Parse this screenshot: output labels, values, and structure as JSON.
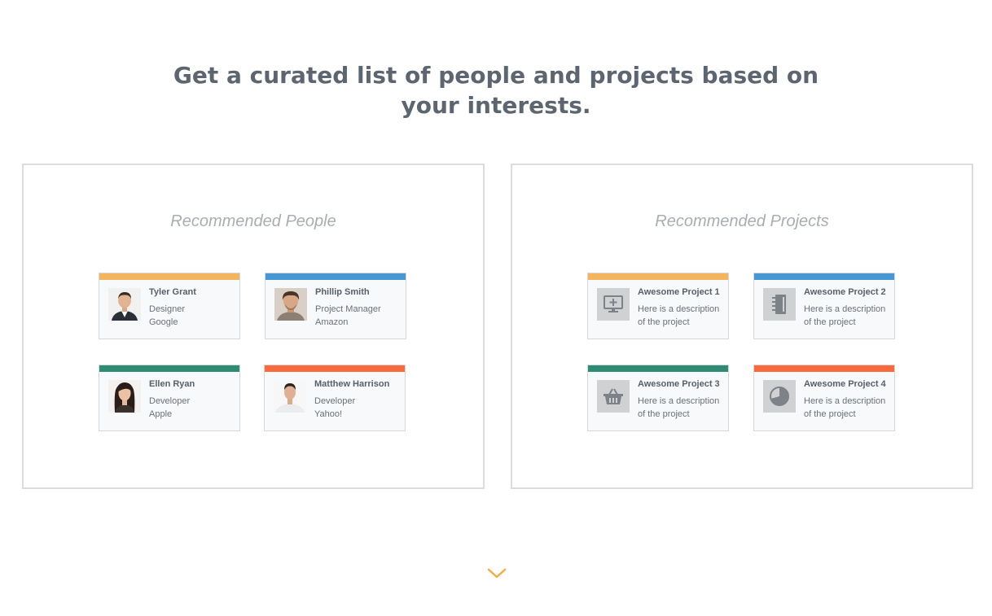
{
  "headline": {
    "line1": "Get a curated list of people and projects based on",
    "line2": "your interests."
  },
  "colors": {
    "yellow": "#f2b45c",
    "blue": "#4896d2",
    "green": "#2e8b74",
    "orange": "#f86a3c",
    "chevron": "#f0ad4e"
  },
  "people_panel": {
    "title": "Recommended People",
    "cards": [
      {
        "name": "Tyler Grant",
        "role": "Designer",
        "company": "Google",
        "accent": "yellow"
      },
      {
        "name": "Phillip Smith",
        "role": "Project Manager",
        "company": "Amazon",
        "accent": "blue"
      },
      {
        "name": "Ellen Ryan",
        "role": "Developer",
        "company": "Apple",
        "accent": "green"
      },
      {
        "name": "Matthew Harrison",
        "role": "Developer",
        "company": "Yahoo!",
        "accent": "orange"
      }
    ]
  },
  "projects_panel": {
    "title": "Recommended Projects",
    "cards": [
      {
        "name": "Awesome Project 1",
        "desc1": "Here is a description",
        "desc2": "of the project",
        "icon": "monitor-icon",
        "accent": "yellow"
      },
      {
        "name": "Awesome Project 2",
        "desc1": "Here is a description",
        "desc2": "of the project",
        "icon": "notebook-icon",
        "accent": "blue"
      },
      {
        "name": "Awesome Project 3",
        "desc1": "Here is a description",
        "desc2": "of the project",
        "icon": "basket-icon",
        "accent": "green"
      },
      {
        "name": "Awesome Project 4",
        "desc1": "Here is a description",
        "desc2": "of the project",
        "icon": "pie-chart-icon",
        "accent": "orange"
      }
    ]
  },
  "scroll_indicator": {
    "icon": "chevron-down-icon"
  }
}
